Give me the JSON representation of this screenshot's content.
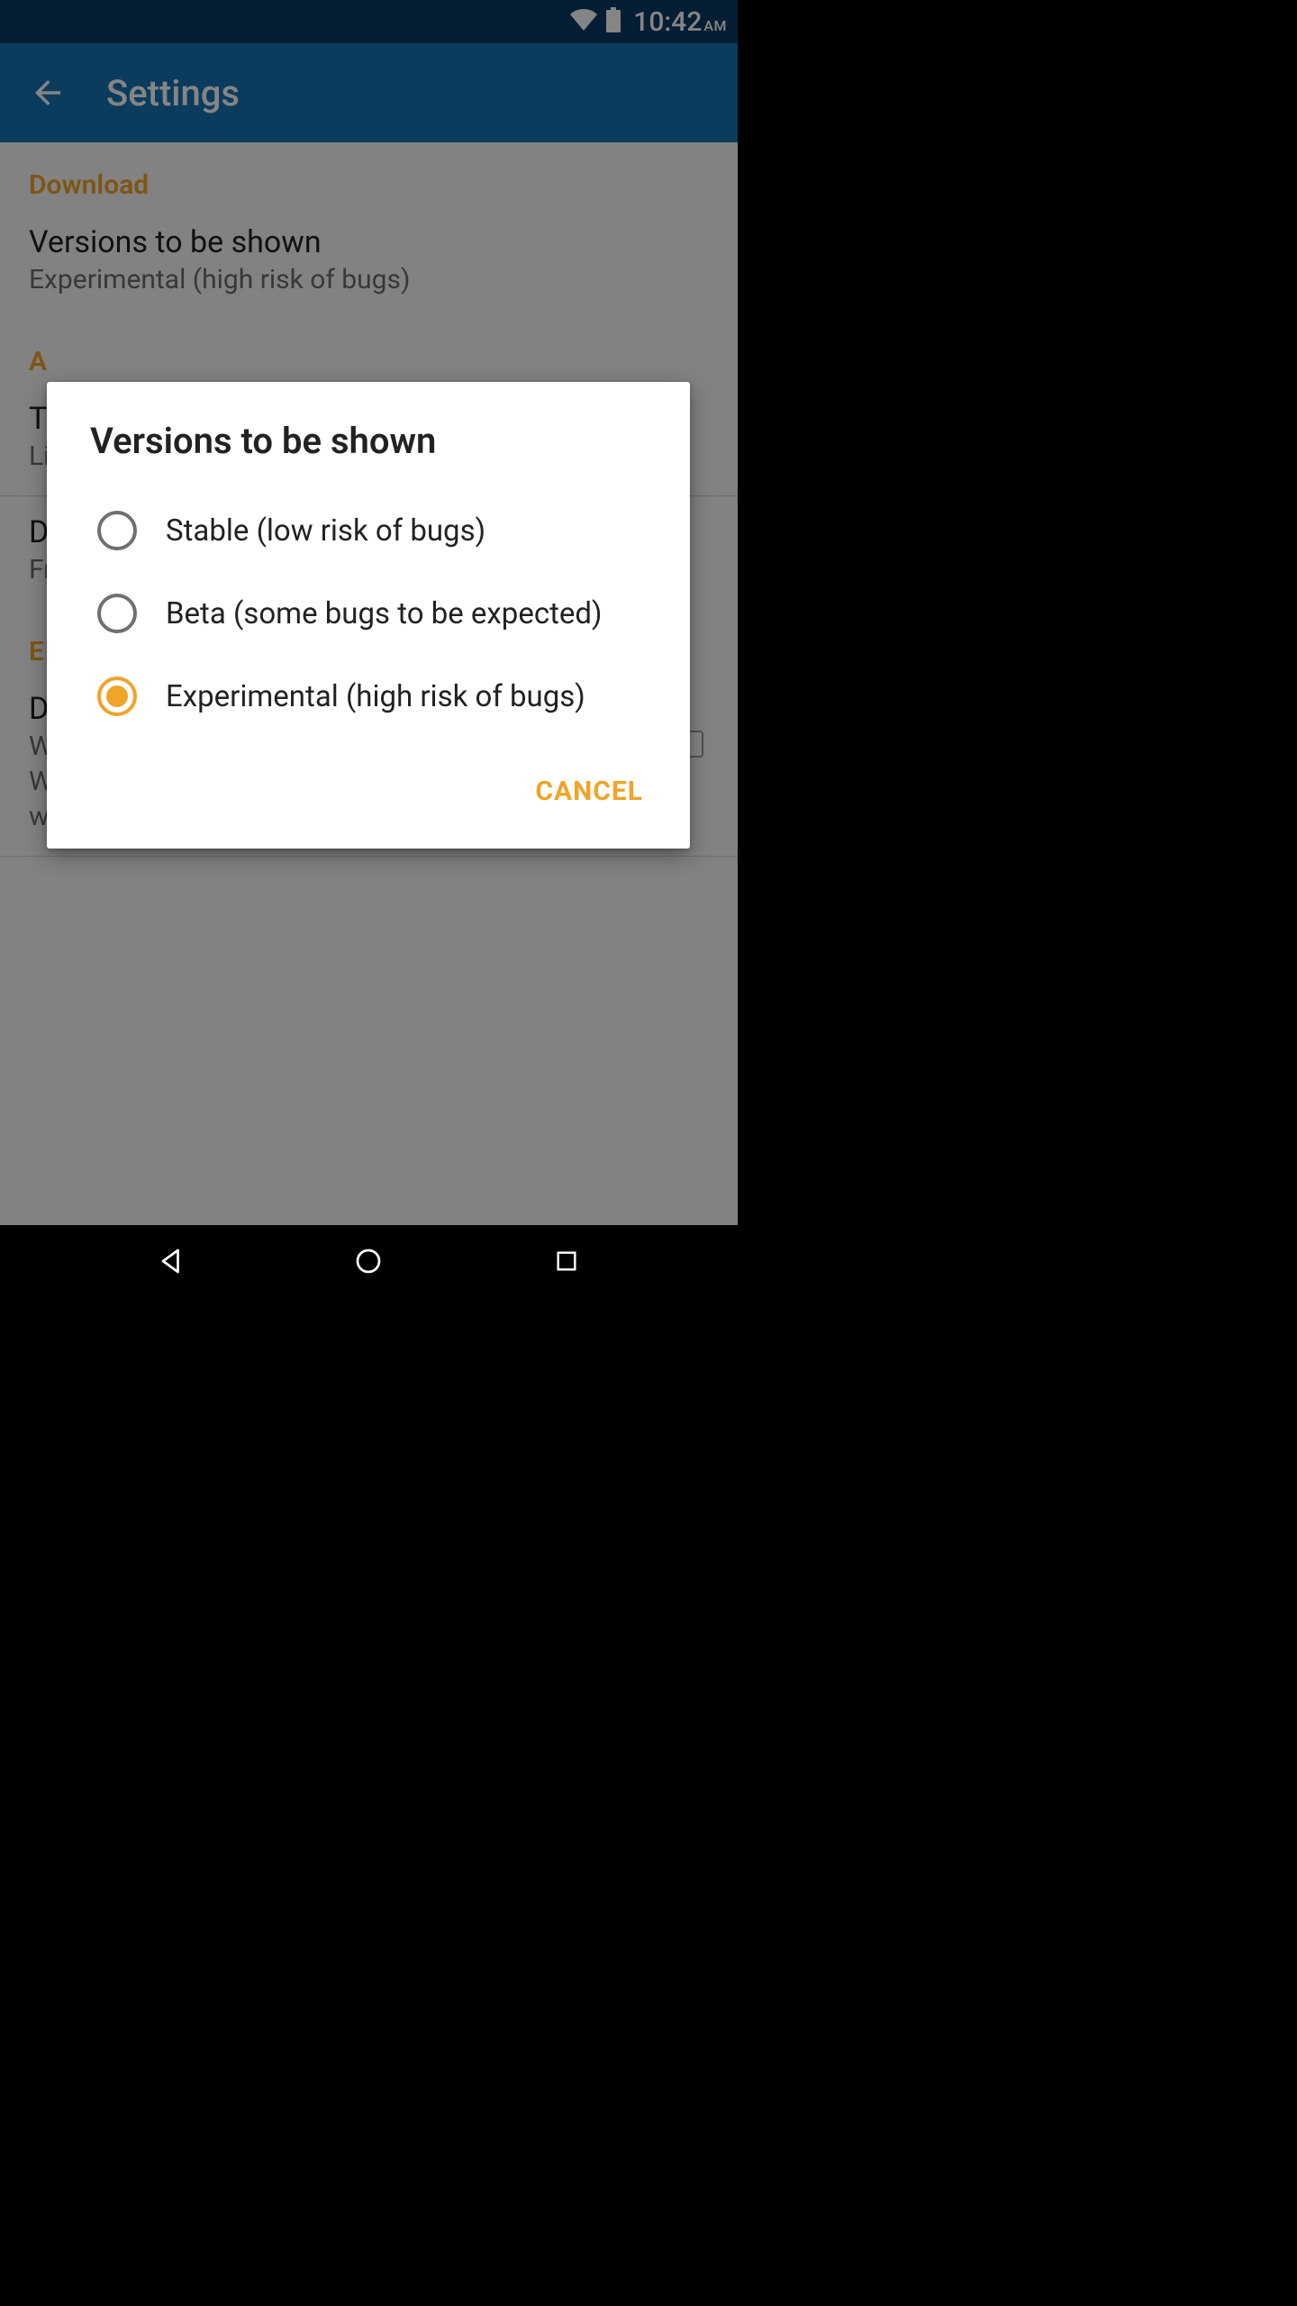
{
  "status": {
    "clock_time": "10:42",
    "clock_ampm": "AM"
  },
  "appbar": {
    "title": "Settings"
  },
  "sections": {
    "download": {
      "header": "Download",
      "item": {
        "title": "Versions to be shown",
        "subtitle": "Experimental (high risk of bugs)"
      }
    },
    "appearance_header_fragment": "A",
    "row2": {
      "title_fragment": "T",
      "subtitle_fragment": "Li"
    },
    "row3": {
      "title_fragment": "D",
      "subtitle_fragment": "Fr"
    },
    "experimental_header_fragment": "E",
    "row4": {
      "title_fragment": "D",
      "sub_line1_fragment": "W",
      "sub_line2_fragment": "W",
      "sub_line3_fragment": "will not work when this is enabled."
    }
  },
  "dialog": {
    "title": "Versions to be shown",
    "options": [
      {
        "label": "Stable (low risk of bugs)",
        "selected": false
      },
      {
        "label": "Beta (some bugs to be expected)",
        "selected": false
      },
      {
        "label": "Experimental (high risk of bugs)",
        "selected": true
      }
    ],
    "cancel": "CANCEL"
  },
  "colors": {
    "accent": "#f0a429",
    "primary": "#1673b5",
    "status_bg": "#0b3b63"
  }
}
